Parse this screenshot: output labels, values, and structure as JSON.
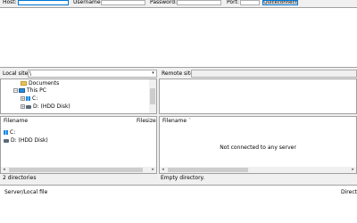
{
  "quickconnect": {
    "host_label": "Host:",
    "username_label": "Username:",
    "password_label": "Password:",
    "port_label": "Port:",
    "button_label": "Quickconnect"
  },
  "local": {
    "site_label": "Local site:",
    "path": "\\",
    "tree": [
      {
        "label": "Documents"
      },
      {
        "label": "This PC"
      },
      {
        "label": "C:"
      },
      {
        "label": "D: (HDD Disk)"
      }
    ],
    "columns": {
      "filename": "Filename",
      "filesize": "Filesize"
    },
    "files": [
      {
        "name": "C:"
      },
      {
        "name": "D: (HDD Disk)"
      }
    ],
    "status": "2 directories"
  },
  "remote": {
    "site_label": "Remote site:",
    "columns": {
      "filename": "Filename"
    },
    "message": "Not connected to any server",
    "status": "Empty directory."
  },
  "queue": {
    "col_server": "Server/Local file",
    "col_direction": "Directi"
  },
  "colors": {
    "accent": "#0078d7",
    "border": "#a0a0a0"
  }
}
